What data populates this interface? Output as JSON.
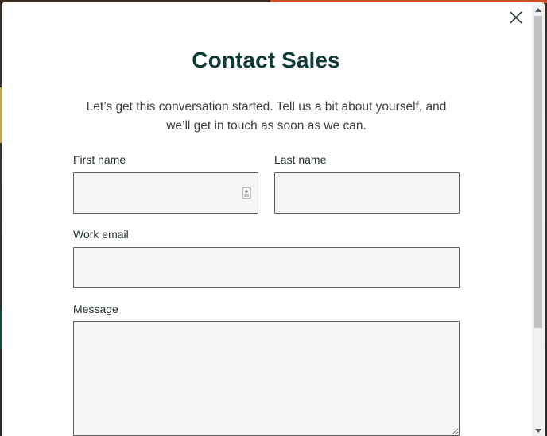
{
  "modal": {
    "title": "Contact Sales",
    "subtitle": "Let’s get this conversation started. Tell us a bit about yourself, and we’ll get in touch as soon as we can.",
    "close_icon": "close-icon"
  },
  "form": {
    "first_name": {
      "label": "First name",
      "value": "",
      "placeholder": ""
    },
    "last_name": {
      "label": "Last name",
      "value": "",
      "placeholder": ""
    },
    "work_email": {
      "label": "Work email",
      "value": "",
      "placeholder": ""
    },
    "message": {
      "label": "Message",
      "value": "",
      "placeholder": ""
    },
    "autofill_icon": "contact-card-icon"
  },
  "colors": {
    "title": "#0f3a37",
    "field_background": "#f5f6f5",
    "field_border": "#5a5f5d"
  }
}
